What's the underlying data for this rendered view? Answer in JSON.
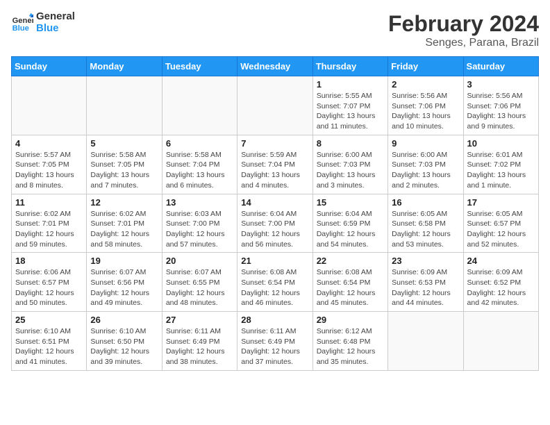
{
  "header": {
    "logo_line1": "General",
    "logo_line2": "Blue",
    "title": "February 2024",
    "subtitle": "Senges, Parana, Brazil"
  },
  "days_of_week": [
    "Sunday",
    "Monday",
    "Tuesday",
    "Wednesday",
    "Thursday",
    "Friday",
    "Saturday"
  ],
  "weeks": [
    [
      {
        "day": "",
        "info": ""
      },
      {
        "day": "",
        "info": ""
      },
      {
        "day": "",
        "info": ""
      },
      {
        "day": "",
        "info": ""
      },
      {
        "day": "1",
        "info": "Sunrise: 5:55 AM\nSunset: 7:07 PM\nDaylight: 13 hours and 11 minutes."
      },
      {
        "day": "2",
        "info": "Sunrise: 5:56 AM\nSunset: 7:06 PM\nDaylight: 13 hours and 10 minutes."
      },
      {
        "day": "3",
        "info": "Sunrise: 5:56 AM\nSunset: 7:06 PM\nDaylight: 13 hours and 9 minutes."
      }
    ],
    [
      {
        "day": "4",
        "info": "Sunrise: 5:57 AM\nSunset: 7:05 PM\nDaylight: 13 hours and 8 minutes."
      },
      {
        "day": "5",
        "info": "Sunrise: 5:58 AM\nSunset: 7:05 PM\nDaylight: 13 hours and 7 minutes."
      },
      {
        "day": "6",
        "info": "Sunrise: 5:58 AM\nSunset: 7:04 PM\nDaylight: 13 hours and 6 minutes."
      },
      {
        "day": "7",
        "info": "Sunrise: 5:59 AM\nSunset: 7:04 PM\nDaylight: 13 hours and 4 minutes."
      },
      {
        "day": "8",
        "info": "Sunrise: 6:00 AM\nSunset: 7:03 PM\nDaylight: 13 hours and 3 minutes."
      },
      {
        "day": "9",
        "info": "Sunrise: 6:00 AM\nSunset: 7:03 PM\nDaylight: 13 hours and 2 minutes."
      },
      {
        "day": "10",
        "info": "Sunrise: 6:01 AM\nSunset: 7:02 PM\nDaylight: 13 hours and 1 minute."
      }
    ],
    [
      {
        "day": "11",
        "info": "Sunrise: 6:02 AM\nSunset: 7:01 PM\nDaylight: 12 hours and 59 minutes."
      },
      {
        "day": "12",
        "info": "Sunrise: 6:02 AM\nSunset: 7:01 PM\nDaylight: 12 hours and 58 minutes."
      },
      {
        "day": "13",
        "info": "Sunrise: 6:03 AM\nSunset: 7:00 PM\nDaylight: 12 hours and 57 minutes."
      },
      {
        "day": "14",
        "info": "Sunrise: 6:04 AM\nSunset: 7:00 PM\nDaylight: 12 hours and 56 minutes."
      },
      {
        "day": "15",
        "info": "Sunrise: 6:04 AM\nSunset: 6:59 PM\nDaylight: 12 hours and 54 minutes."
      },
      {
        "day": "16",
        "info": "Sunrise: 6:05 AM\nSunset: 6:58 PM\nDaylight: 12 hours and 53 minutes."
      },
      {
        "day": "17",
        "info": "Sunrise: 6:05 AM\nSunset: 6:57 PM\nDaylight: 12 hours and 52 minutes."
      }
    ],
    [
      {
        "day": "18",
        "info": "Sunrise: 6:06 AM\nSunset: 6:57 PM\nDaylight: 12 hours and 50 minutes."
      },
      {
        "day": "19",
        "info": "Sunrise: 6:07 AM\nSunset: 6:56 PM\nDaylight: 12 hours and 49 minutes."
      },
      {
        "day": "20",
        "info": "Sunrise: 6:07 AM\nSunset: 6:55 PM\nDaylight: 12 hours and 48 minutes."
      },
      {
        "day": "21",
        "info": "Sunrise: 6:08 AM\nSunset: 6:54 PM\nDaylight: 12 hours and 46 minutes."
      },
      {
        "day": "22",
        "info": "Sunrise: 6:08 AM\nSunset: 6:54 PM\nDaylight: 12 hours and 45 minutes."
      },
      {
        "day": "23",
        "info": "Sunrise: 6:09 AM\nSunset: 6:53 PM\nDaylight: 12 hours and 44 minutes."
      },
      {
        "day": "24",
        "info": "Sunrise: 6:09 AM\nSunset: 6:52 PM\nDaylight: 12 hours and 42 minutes."
      }
    ],
    [
      {
        "day": "25",
        "info": "Sunrise: 6:10 AM\nSunset: 6:51 PM\nDaylight: 12 hours and 41 minutes."
      },
      {
        "day": "26",
        "info": "Sunrise: 6:10 AM\nSunset: 6:50 PM\nDaylight: 12 hours and 39 minutes."
      },
      {
        "day": "27",
        "info": "Sunrise: 6:11 AM\nSunset: 6:49 PM\nDaylight: 12 hours and 38 minutes."
      },
      {
        "day": "28",
        "info": "Sunrise: 6:11 AM\nSunset: 6:49 PM\nDaylight: 12 hours and 37 minutes."
      },
      {
        "day": "29",
        "info": "Sunrise: 6:12 AM\nSunset: 6:48 PM\nDaylight: 12 hours and 35 minutes."
      },
      {
        "day": "",
        "info": ""
      },
      {
        "day": "",
        "info": ""
      }
    ]
  ]
}
